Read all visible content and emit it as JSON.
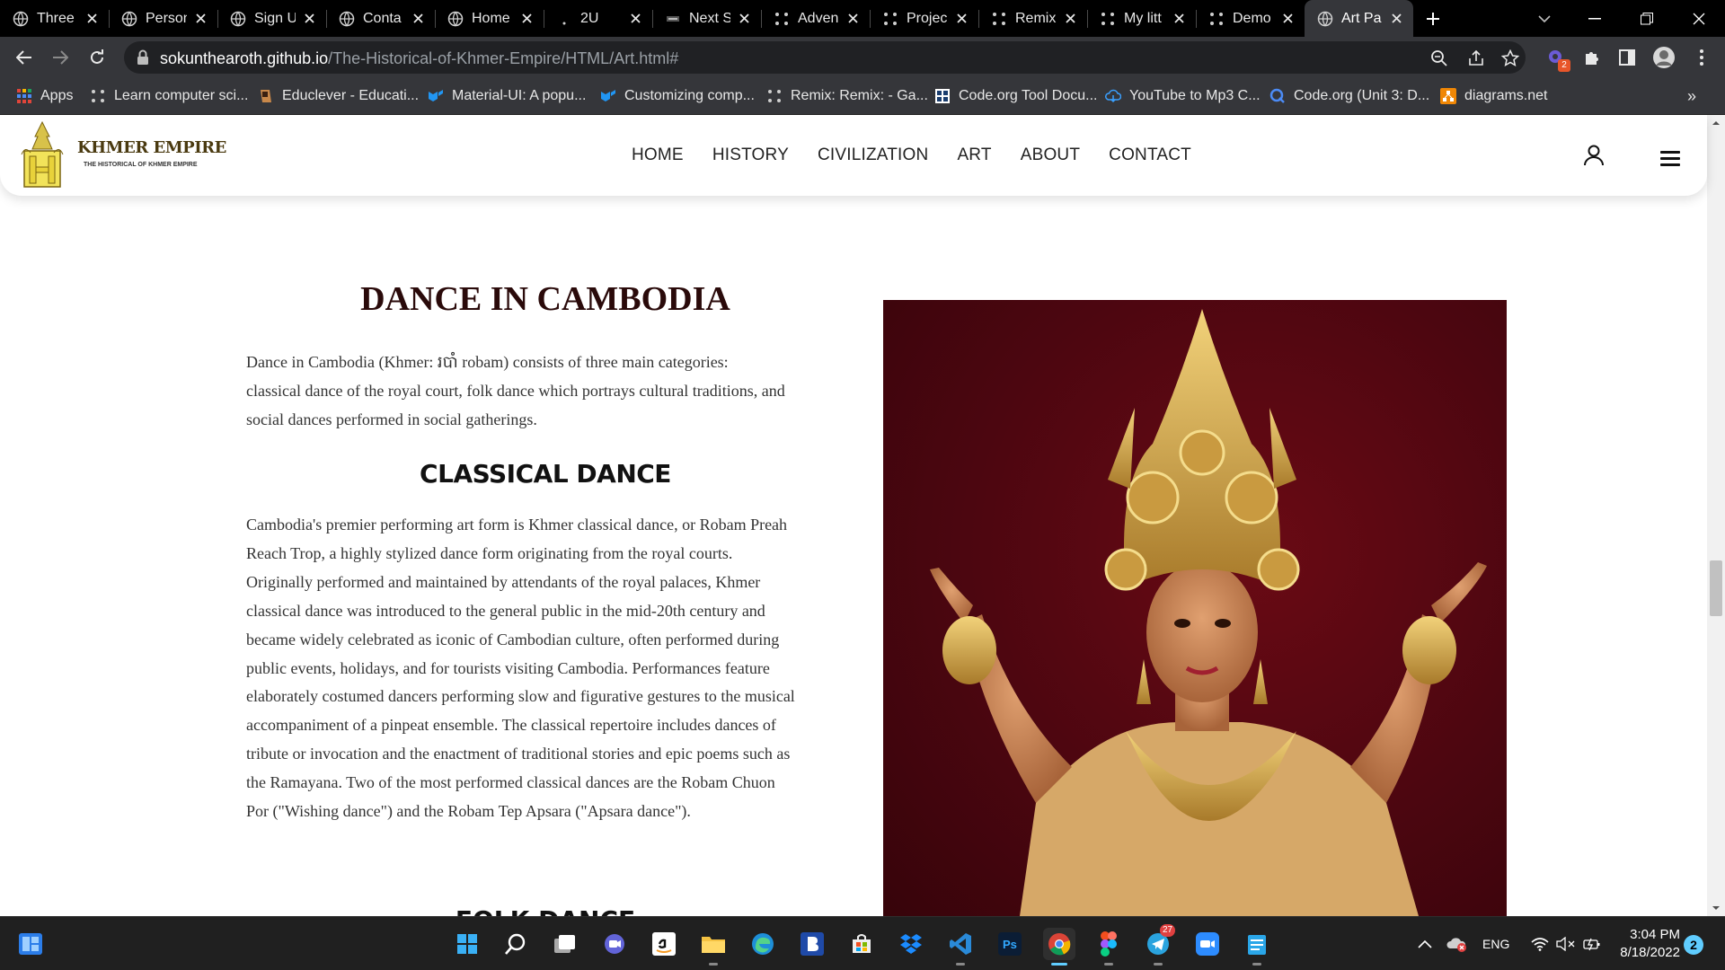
{
  "browser": {
    "tabs": [
      {
        "title": "Three",
        "favicon": "globe-icon"
      },
      {
        "title": "Person",
        "favicon": "globe-icon"
      },
      {
        "title": "Sign Up",
        "favicon": "globe-icon"
      },
      {
        "title": "Conta",
        "favicon": "globe-icon"
      },
      {
        "title": "Home",
        "favicon": "globe-icon"
      },
      {
        "title": "2U",
        "favicon": "dot-icon"
      },
      {
        "title": "Next S",
        "favicon": "next-icon"
      },
      {
        "title": "Adven",
        "favicon": "codeorg-icon"
      },
      {
        "title": "Projec",
        "favicon": "codeorg-icon"
      },
      {
        "title": "Remix",
        "favicon": "codeorg-icon"
      },
      {
        "title": "My litt",
        "favicon": "codeorg-icon"
      },
      {
        "title": "Demo",
        "favicon": "codeorg-icon"
      },
      {
        "title": "Art Pa",
        "favicon": "globe-icon",
        "active": true
      }
    ],
    "new_tab_label": "+",
    "url_host": "sokunthearoth.github.io",
    "url_path": "/The-Historical-of-Khmer-Empire/HTML/Art.html#",
    "extension_badge": "2",
    "bookmarks": [
      {
        "label": "Apps",
        "icon": "apps-grid-icon"
      },
      {
        "label": "Learn computer sci...",
        "icon": "codeorg-icon"
      },
      {
        "label": "Educlever - Educati...",
        "icon": "educlever-icon"
      },
      {
        "label": "Material-UI: A popu...",
        "icon": "mui-icon"
      },
      {
        "label": "Customizing comp...",
        "icon": "mui-icon"
      },
      {
        "label": "Remix: Remix: - Ga...",
        "icon": "codeorg-icon"
      },
      {
        "label": "Code.org Tool Docu...",
        "icon": "codeorg-tool-icon"
      },
      {
        "label": "YouTube to Mp3 C...",
        "icon": "cloud-download-icon"
      },
      {
        "label": "Code.org (Unit 3: D...",
        "icon": "search-q-icon"
      },
      {
        "label": "diagrams.net",
        "icon": "diagrams-icon"
      }
    ],
    "bookmarks_overflow": "»"
  },
  "site": {
    "brand_name": "KHMER EMPIRE",
    "brand_tagline": "THE HISTORICAL OF KHMER EMPIRE",
    "nav": [
      "HOME",
      "HISTORY",
      "CIVILIZATION",
      "ART",
      "ABOUT",
      "CONTACT"
    ]
  },
  "article": {
    "heading": "DANCE IN CAMBODIA",
    "intro": "Dance in Cambodia (Khmer: របាំ robam) consists of three main categories: classical dance of the royal court, folk dance which portrays cultural traditions, and social dances performed in social gatherings.",
    "classical_heading": "CLASSICAL DANCE",
    "classical_text": "Cambodia's premier performing art form is Khmer classical dance, or Robam Preah Reach Trop, a highly stylized dance form originating from the royal courts. Originally performed and maintained by attendants of the royal palaces, Khmer classical dance was introduced to the general public in the mid-20th century and became widely celebrated as iconic of Cambodian culture, often performed during public events, holidays, and for tourists visiting Cambodia. Performances feature elaborately costumed dancers performing slow and figurative gestures to the musical accompaniment of a pinpeat ensemble. The classical repertoire includes dances of tribute or invocation and the enactment of traditional stories and epic poems such as the Ramayana. Two of the most performed classical dances are the Robam Chuon Por (\"Wishing dance\") and the Robam Tep Apsara (\"Apsara dance\").",
    "next_heading": "FOLK DANCE"
  },
  "taskbar": {
    "apps": [
      "windows-start-icon",
      "search-icon",
      "task-view-icon",
      "teams-chat-icon",
      "amazon-icon",
      "file-explorer-icon",
      "edge-icon",
      "b-app-icon",
      "store-icon",
      "dropbox-icon",
      "vscode-icon",
      "photoshop-icon",
      "chrome-icon",
      "figma-icon",
      "telegram-icon",
      "zoom-icon",
      "notepad-icon"
    ],
    "telegram_badge": "27",
    "language": "ENG",
    "time": "3:04 PM",
    "date": "8/18/2022",
    "notification_count": "2"
  }
}
